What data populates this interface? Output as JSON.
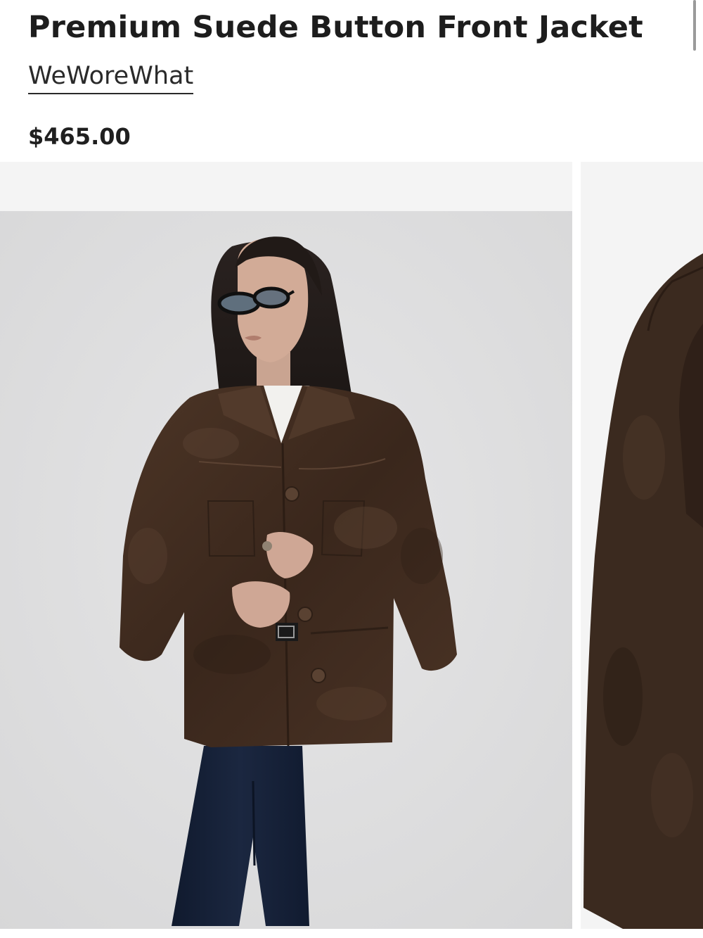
{
  "product": {
    "title": "Premium Suede Button Front Jacket",
    "brand": "WeWoreWhat",
    "price": "$465.00"
  },
  "gallery": {
    "images": [
      {
        "alt": "Model wearing brown suede button front jacket with dark jeans and sunglasses"
      },
      {
        "alt": "Close-up of brown suede jacket"
      }
    ]
  },
  "colors": {
    "suede": "#3e2a1f",
    "suede_light": "#5a4131",
    "denim": "#152038",
    "background": "#dcdcdd",
    "placeholder": "#f4f4f4"
  }
}
